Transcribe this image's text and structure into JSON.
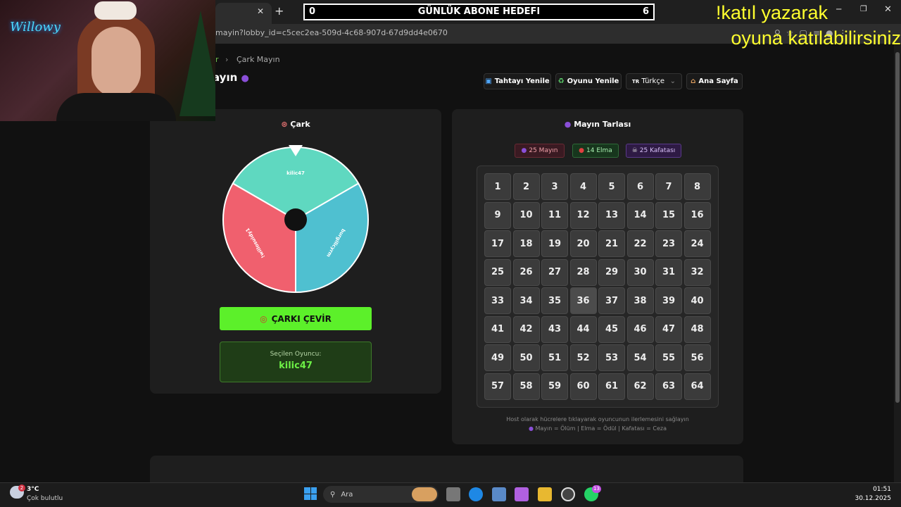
{
  "overlay": {
    "goal_left": "0",
    "goal_title": "GÜNLÜK ABONE HEDEFI",
    "goal_right": "6",
    "join_line1": "!katıl yazarak",
    "join_line2": "oyuna katılabilirsiniz",
    "streamer_logo": "Willowy"
  },
  "browser": {
    "url": "mayin?lobby_id=c5cec2ea-509d-4c68-907d-67d9dd4e0670"
  },
  "page": {
    "breadcrumb_prefix": "r",
    "breadcrumb": "Çark Mayın",
    "title": "ayın",
    "buttons": {
      "refresh_board": "Tahtayı Yenile",
      "restart_game": "Oyunu Yenile",
      "language": "Türkçe",
      "language_flag": "TR",
      "home": "Ana Sayfa"
    }
  },
  "wheel_card": {
    "title": "Çark",
    "segments": [
      "kilic47",
      "burgilicyrm",
      "!willosuidy1"
    ],
    "segment_colors": [
      "#5fd8c0",
      "#4fc0d0",
      "#f0606e"
    ],
    "spin_button": "ÇARKI ÇEVİR",
    "selected_label": "Seçilen Oyuncu:",
    "selected_player": "kilic47"
  },
  "mine_card": {
    "title": "Mayın Tarlası",
    "badges": {
      "mines": "25 Mayın",
      "apples": "14 Elma",
      "skulls": "25 Kafatası"
    },
    "cells": [
      "1",
      "2",
      "3",
      "4",
      "5",
      "6",
      "7",
      "8",
      "9",
      "10",
      "11",
      "12",
      "13",
      "14",
      "15",
      "16",
      "17",
      "18",
      "19",
      "20",
      "21",
      "22",
      "23",
      "24",
      "25",
      "26",
      "27",
      "28",
      "29",
      "30",
      "31",
      "32",
      "33",
      "34",
      "35",
      "36",
      "37",
      "38",
      "39",
      "40",
      "41",
      "42",
      "43",
      "44",
      "45",
      "46",
      "47",
      "48",
      "49",
      "50",
      "51",
      "52",
      "53",
      "54",
      "55",
      "56",
      "57",
      "58",
      "59",
      "60",
      "61",
      "62",
      "63",
      "64"
    ],
    "hint": "Host olarak hücrelere tıklayarak oyuncunun ilerlemesini sağlayın",
    "legend": "Mayın = Ölüm | Elma = Ödül | Kafatası = Ceza"
  },
  "taskbar": {
    "weather_temp": "3°C",
    "weather_desc": "Çok bulutlu",
    "search": "Ara",
    "time": "01:51",
    "date": "30.12.2025",
    "weather_badge": "2",
    "whatsapp_badge": "13"
  }
}
